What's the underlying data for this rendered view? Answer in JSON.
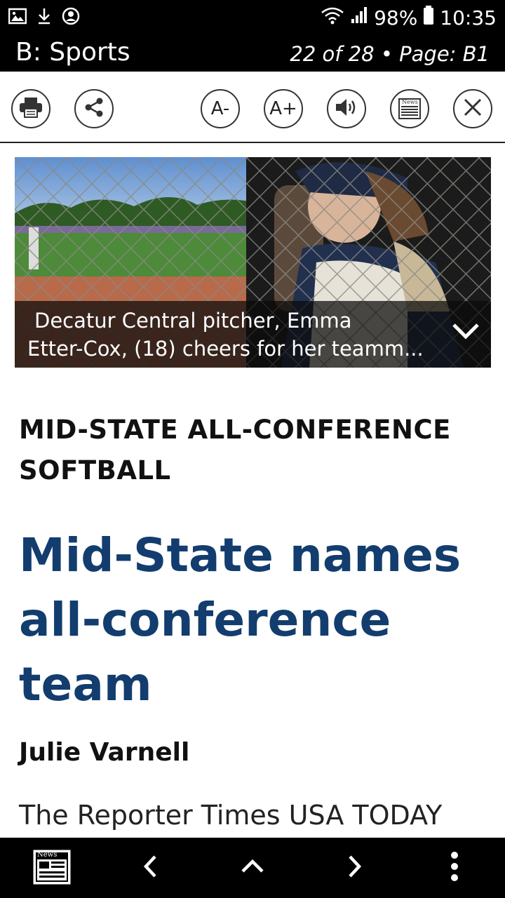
{
  "status_bar": {
    "battery": "98%",
    "time": "10:35",
    "icons": [
      "image-icon",
      "download-icon",
      "account-icon",
      "wifi-icon",
      "signal-icon",
      "battery-icon"
    ]
  },
  "header": {
    "section": "B: Sports",
    "page_info": "22 of 28 • Page: B1"
  },
  "toolbar": {
    "buttons": [
      {
        "name": "print",
        "icon": "printer-icon"
      },
      {
        "name": "share",
        "icon": "share-icon"
      },
      {
        "name": "font-decrease",
        "label": "A-"
      },
      {
        "name": "font-increase",
        "label": "A+"
      },
      {
        "name": "audio",
        "icon": "speaker-icon"
      },
      {
        "name": "newspaper",
        "icon": "newspaper-icon",
        "label": "News"
      },
      {
        "name": "close",
        "icon": "close-icon"
      }
    ]
  },
  "photo": {
    "caption_line1": "Decatur Central pitcher, Emma",
    "caption_line2": "Etter-Cox, (18) cheers for her teamm..."
  },
  "article": {
    "kicker": "MID-STATE ALL-CONFERENCE SOFTBALL",
    "headline": "Mid-State names all-conference team",
    "byline": "Julie Varnell",
    "source": "The Reporter Times USA TODAY"
  },
  "bottom_nav": {
    "items": [
      "newspaper-icon",
      "chevron-left-icon",
      "chevron-up-icon",
      "chevron-right-icon",
      "more-vert-icon"
    ],
    "news_label": "News"
  },
  "colors": {
    "headline": "#123d6e",
    "bars": "#000000"
  }
}
